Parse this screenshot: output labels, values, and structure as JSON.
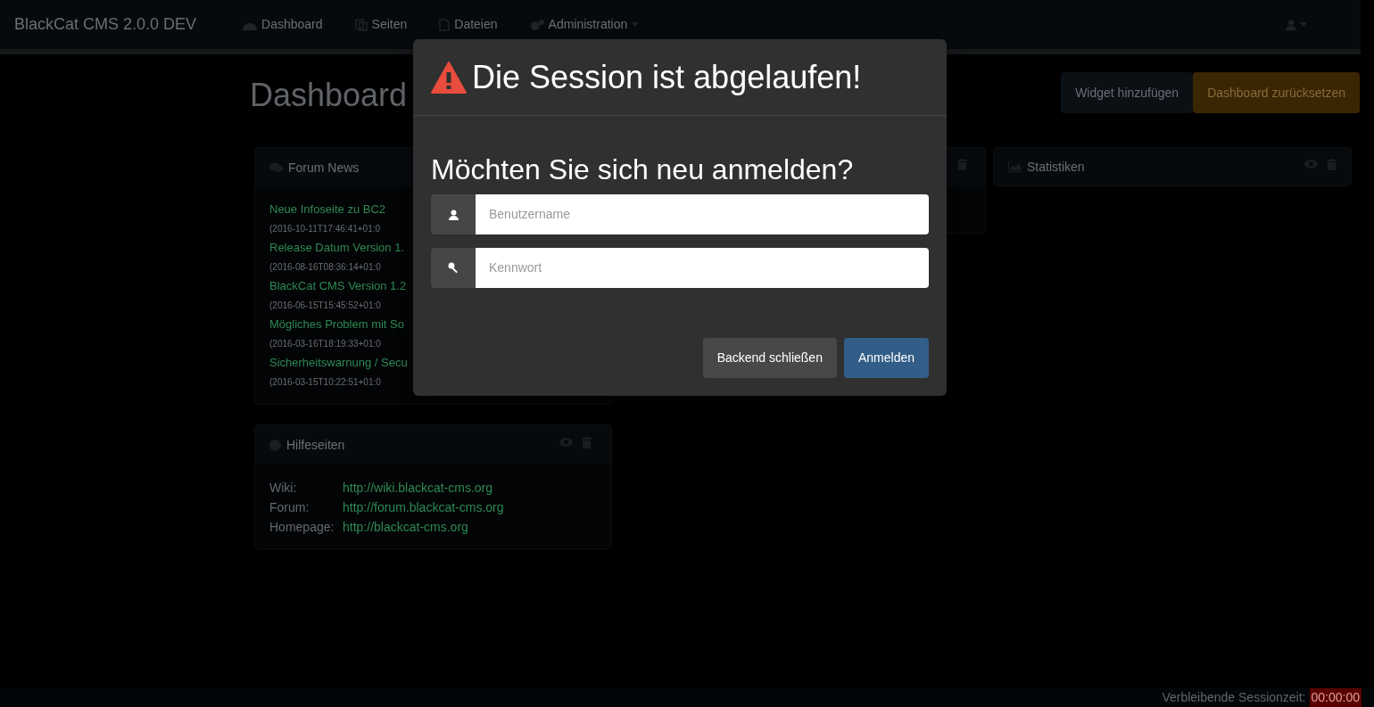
{
  "navbar": {
    "brand": "BlackCat CMS 2.0.0 DEV",
    "items": [
      {
        "label": "Dashboard"
      },
      {
        "label": "Seiten"
      },
      {
        "label": "Dateien"
      },
      {
        "label": "Administration"
      }
    ]
  },
  "page": {
    "title": "Dashboard",
    "buttons": [
      {
        "label": "Widget hinzufügen",
        "kind": "default"
      },
      {
        "label": "Dashboard zurücksetzen",
        "kind": "warning"
      }
    ]
  },
  "widgets": {
    "forum_news": {
      "title": "Forum News",
      "items": [
        {
          "title": "Neue Infoseite zu BC2",
          "date": "(2016-10-11T17:46:41+01:0"
        },
        {
          "title": "Release Datum Version 1.",
          "date": "(2016-08-16T08:36:14+01:0"
        },
        {
          "title": "BlackCat CMS Version 1.2",
          "date": "(2016-06-15T15:45:52+01:0"
        },
        {
          "title": "Mögliches Problem mit So",
          "date": "(2016-03-16T18:19:33+01:0"
        },
        {
          "title": "Sicherheitswarnung / Secu",
          "date": "(2016-03-15T10:22:51+01:0"
        }
      ]
    },
    "help": {
      "title": "Hilfeseiten",
      "links": [
        {
          "label": "Wiki:",
          "url": "http://wiki.blackcat-cms.org"
        },
        {
          "label": "Forum:",
          "url": "http://forum.blackcat-cms.org"
        },
        {
          "label": "Homepage:",
          "url": "http://blackcat-cms.org"
        }
      ]
    },
    "statistics": {
      "title": "Statistiken"
    }
  },
  "modal": {
    "title": "Die Session ist abgelaufen!",
    "question": "Möchten Sie sich neu anmelden?",
    "fields": [
      {
        "placeholder": "Benutzername",
        "kind": "user"
      },
      {
        "placeholder": "Kennwort",
        "kind": "password"
      }
    ],
    "buttons": [
      {
        "label": "Backend schließen",
        "kind": "default"
      },
      {
        "label": "Anmelden",
        "kind": "primary"
      }
    ]
  },
  "status_bar": {
    "label": "Verbleibende Sessionzeit:",
    "time": "00:00:00"
  }
}
